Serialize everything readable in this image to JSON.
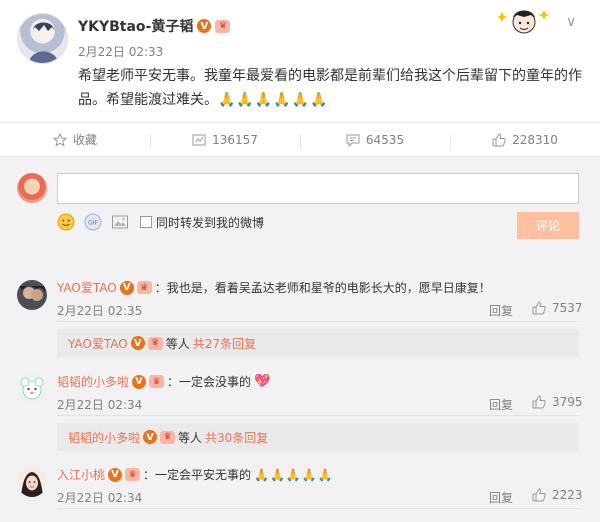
{
  "post": {
    "author": "YKYBtao-黄子韬",
    "badge_v": "V",
    "time": "2月22日 02:33",
    "text": "希望老师平安无事。我童年最爱看的电影都是前辈们给我这个后辈留下的童年的作品。希望能渡过难关。",
    "emoji": "🙏🙏🙏🙏🙏🙏"
  },
  "actions": {
    "favorite_label": "收藏",
    "repost_count": "136157",
    "comment_count": "64535",
    "like_count": "228310"
  },
  "composer": {
    "input_value": "",
    "repost_label": "同时转发到我的微博",
    "submit_label": "评论"
  },
  "comments": [
    {
      "user": "YAO爱TAO",
      "text": "：我也是，看着吴孟达老师和星爷的电影长大的，愿早日康复！",
      "time": "2月22日 02:35",
      "reply_label": "回复",
      "likes": "7537",
      "sub_user": "YAO爱TAO",
      "sub_text": "等人",
      "sub_more": "共27条回复"
    },
    {
      "user": "韬韬的小多啦",
      "text": "：一定会没事的",
      "emoji": "💖",
      "time": "2月22日 02:34",
      "reply_label": "回复",
      "likes": "3795",
      "sub_user": "韬韬的小多啦",
      "sub_text": "等人",
      "sub_more": "共30条回复"
    },
    {
      "user": "入江小桃",
      "text": "：一定会平安无事的",
      "emoji": "🙏🙏🙏🙏🙏",
      "time": "2月22日 02:34",
      "reply_label": "回复",
      "likes": "2223"
    }
  ],
  "colors": {
    "accent": "#eb7350",
    "submit": "#ffc09f",
    "badge": "#e8731a"
  }
}
